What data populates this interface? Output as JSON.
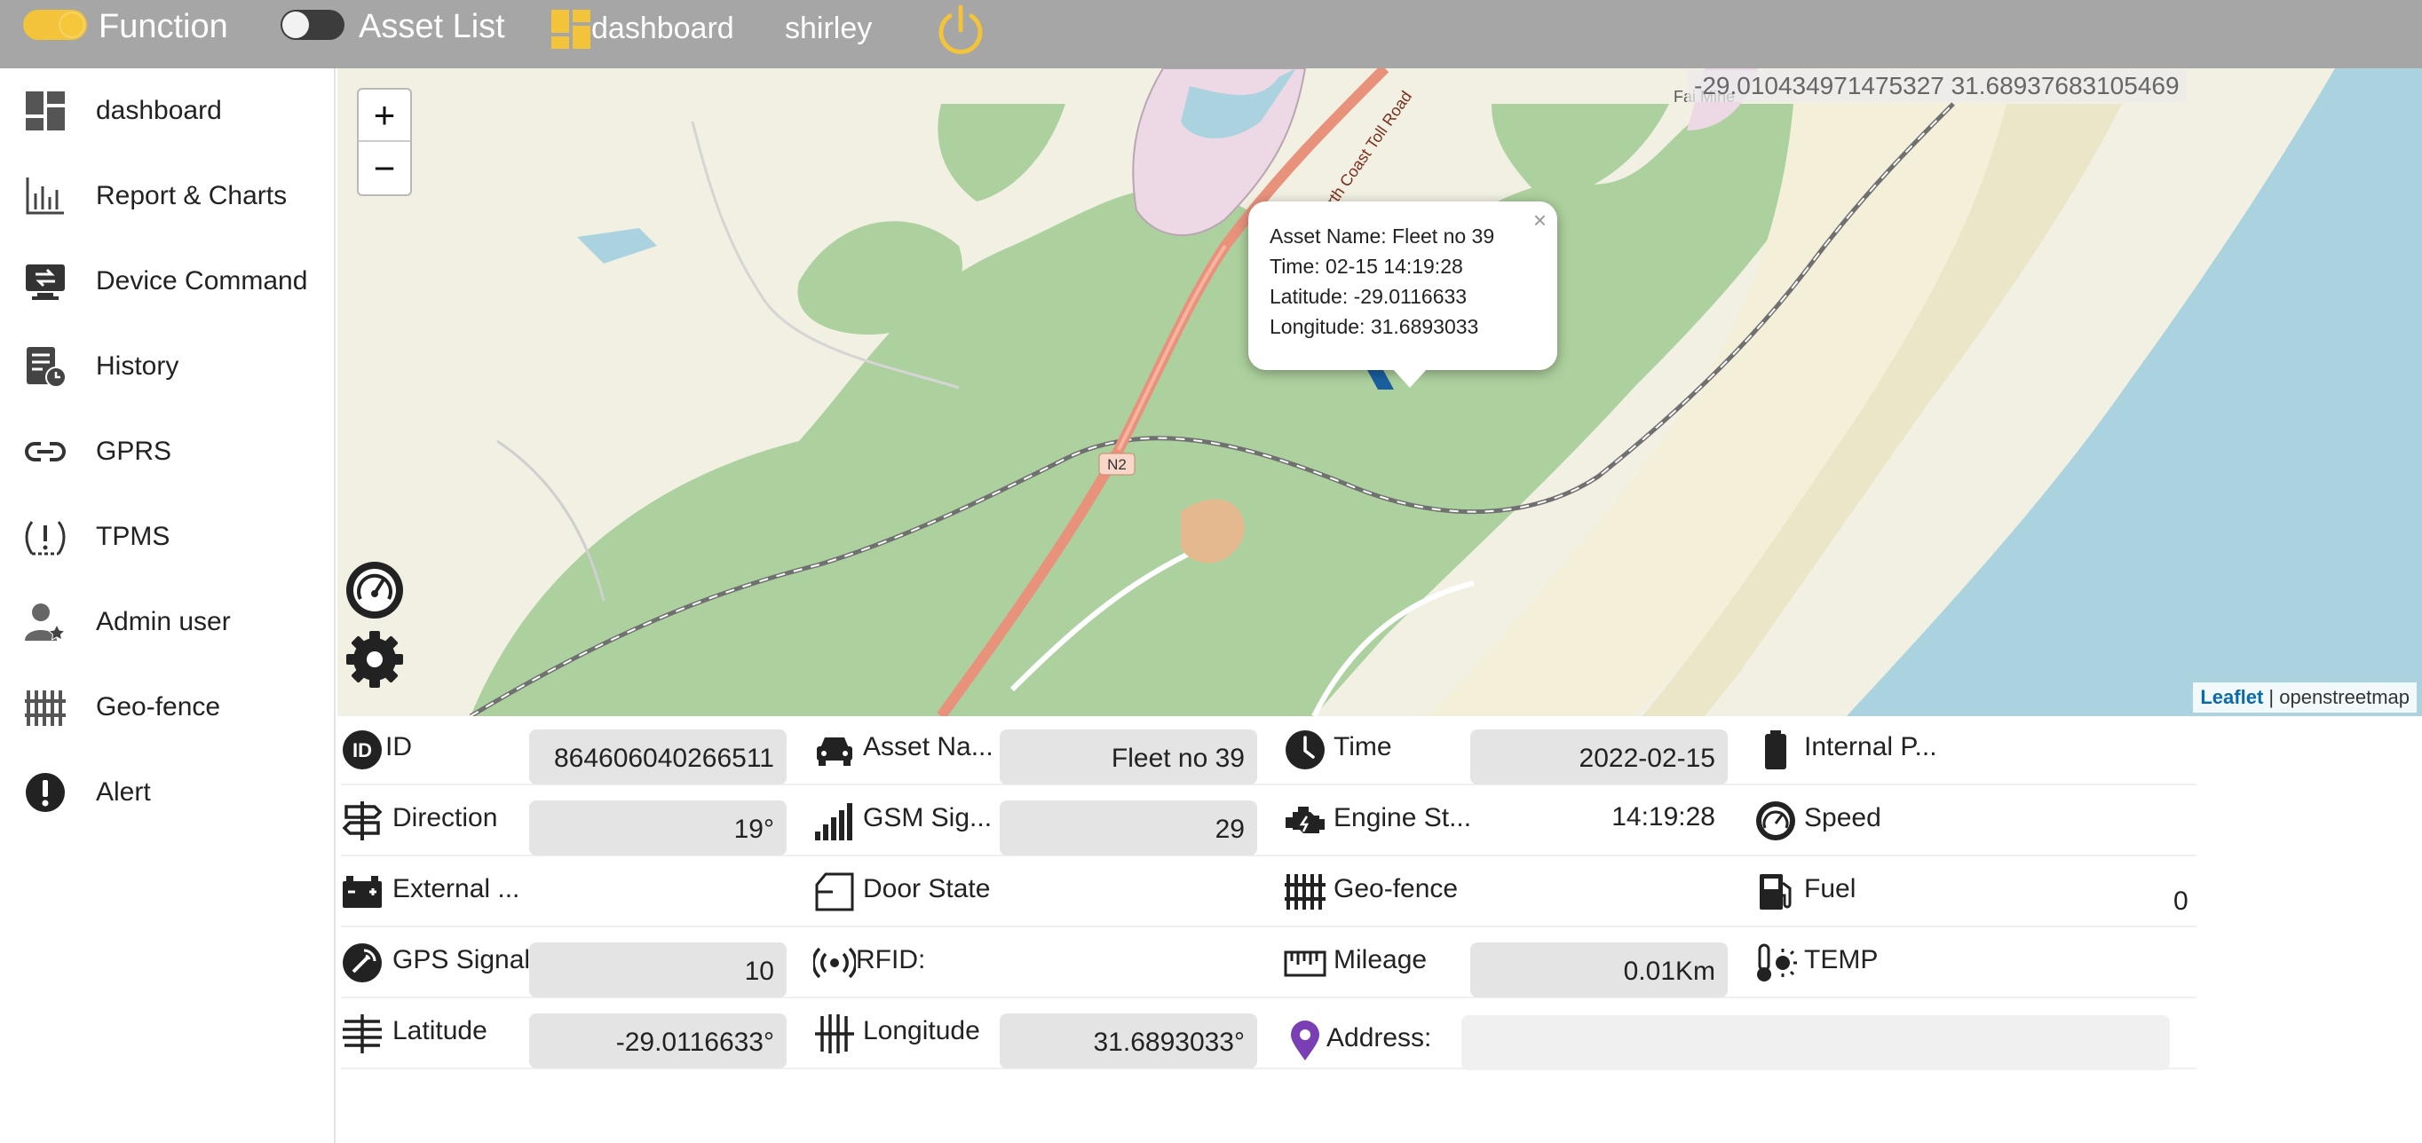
{
  "topbar": {
    "function_label": "Function",
    "asset_list_label": "Asset List",
    "dashboard_label": "dashboard",
    "user_label": "shirley",
    "accent": "#f3c33a"
  },
  "sidebar": {
    "items": [
      {
        "label": "dashboard",
        "icon": "dashboard-icon"
      },
      {
        "label": "Report & Charts",
        "icon": "chart-icon"
      },
      {
        "label": "Device Command",
        "icon": "device-command-icon"
      },
      {
        "label": "History",
        "icon": "history-icon"
      },
      {
        "label": "GPRS",
        "icon": "link-icon"
      },
      {
        "label": "TPMS",
        "icon": "tire-pressure-icon"
      },
      {
        "label": "Admin user",
        "icon": "admin-user-icon"
      },
      {
        "label": "Geo-fence",
        "icon": "fence-icon"
      },
      {
        "label": "Alert",
        "icon": "alert-icon"
      }
    ]
  },
  "map": {
    "zoom_in": "+",
    "zoom_out": "−",
    "coordinates": "-29.010434971475327 31.68937683105469",
    "road_label": "N2",
    "road_name": "North Coast Toll Road",
    "place_label": "Fai Mine",
    "attribution_leaflet": "Leaflet",
    "attribution_sep": " | ",
    "attribution_osm": "openstreetmap",
    "popup": {
      "asset_name": "Asset Name: Fleet no 39",
      "time": "Time: 02-15 14:19:28",
      "latitude": "Latitude: -29.0116633",
      "longitude": "Longitude: 31.6893033",
      "close": "×"
    }
  },
  "info": {
    "id": {
      "label": "ID",
      "value": "864606040266511"
    },
    "asset_name": {
      "label": "Asset Na...",
      "value": "Fleet no 39"
    },
    "time": {
      "label": "Time",
      "value": "2022-02-15 14:19:28"
    },
    "internal_power": {
      "label": "Internal P...",
      "value": ""
    },
    "direction": {
      "label": "Direction",
      "value": "19°"
    },
    "gsm_signal": {
      "label": "GSM Sig...",
      "value": "29"
    },
    "engine_state": {
      "label": "Engine St...",
      "value": ""
    },
    "speed": {
      "label": "Speed",
      "value": ""
    },
    "external_power": {
      "label": "External ...",
      "value": ""
    },
    "door_state": {
      "label": "Door State",
      "value": ""
    },
    "geo_fence": {
      "label": "Geo-fence",
      "value": ""
    },
    "fuel": {
      "label": "Fuel",
      "value": "0"
    },
    "gps_signal": {
      "label": "GPS Signal",
      "value": "10"
    },
    "rfid": {
      "label": "RFID:",
      "value": ""
    },
    "mileage": {
      "label": "Mileage",
      "value": "0.01Km"
    },
    "temp": {
      "label": "TEMP",
      "value": ""
    },
    "latitude": {
      "label": "Latitude",
      "value": "-29.0116633°"
    },
    "longitude": {
      "label": "Longitude",
      "value": "31.6893033°"
    },
    "address": {
      "label": "Address:",
      "value": ""
    }
  }
}
